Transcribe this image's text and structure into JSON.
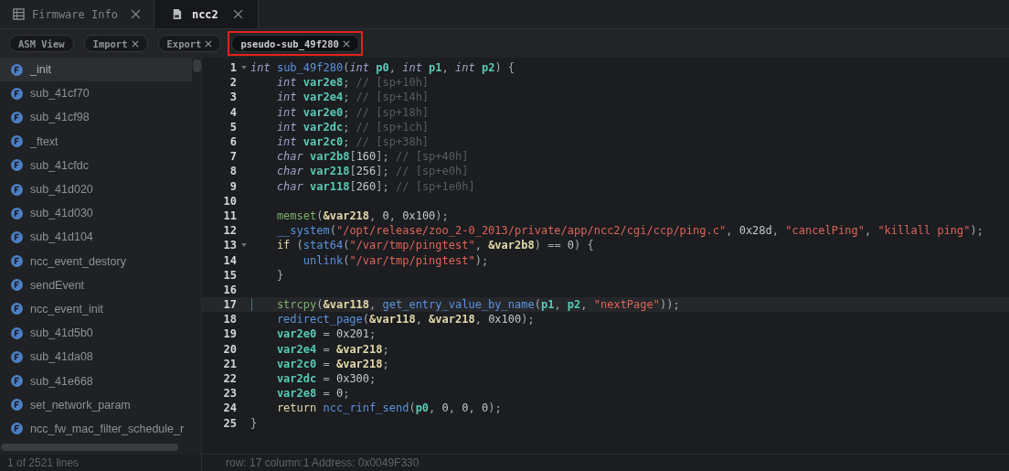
{
  "top_tabs": [
    {
      "label": "Firmware Info",
      "selected": false
    },
    {
      "label": "ncc2",
      "selected": true
    }
  ],
  "view_tabs": [
    {
      "label": "ASM View",
      "closable": false,
      "highlighted": false,
      "selected": false
    },
    {
      "label": "Import",
      "closable": true,
      "highlighted": false,
      "selected": false
    },
    {
      "label": "Export",
      "closable": true,
      "highlighted": false,
      "selected": false
    },
    {
      "label": "pseudo-sub_49f280",
      "closable": true,
      "highlighted": true,
      "selected": true
    }
  ],
  "sidebar": {
    "items": [
      {
        "name": "_init",
        "selected": true
      },
      {
        "name": "sub_41cf70",
        "selected": false
      },
      {
        "name": "sub_41cf98",
        "selected": false
      },
      {
        "name": "_ftext",
        "selected": false
      },
      {
        "name": "sub_41cfdc",
        "selected": false
      },
      {
        "name": "sub_41d020",
        "selected": false
      },
      {
        "name": "sub_41d030",
        "selected": false
      },
      {
        "name": "sub_41d104",
        "selected": false
      },
      {
        "name": "ncc_event_destory",
        "selected": false
      },
      {
        "name": "sendEvent",
        "selected": false
      },
      {
        "name": "ncc_event_init",
        "selected": false
      },
      {
        "name": "sub_41d5b0",
        "selected": false
      },
      {
        "name": "sub_41da08",
        "selected": false
      },
      {
        "name": "sub_41e668",
        "selected": false
      },
      {
        "name": "set_network_param",
        "selected": false
      },
      {
        "name": "ncc_fw_mac_filter_schedule_r",
        "selected": false
      }
    ],
    "status": "1 of 2521 lines"
  },
  "editor": {
    "lines": [
      {
        "n": "1",
        "fold": true,
        "current": false,
        "tokens": [
          {
            "t": "int ",
            "kind": "type"
          },
          {
            "t": "sub_49f280",
            "kind": "func"
          },
          {
            "t": "(",
            "kind": "p"
          },
          {
            "t": "int ",
            "kind": "type"
          },
          {
            "t": "p0",
            "kind": "var"
          },
          {
            "t": ", ",
            "kind": "p"
          },
          {
            "t": "int ",
            "kind": "type"
          },
          {
            "t": "p1",
            "kind": "var"
          },
          {
            "t": ", ",
            "kind": "p"
          },
          {
            "t": "int ",
            "kind": "type"
          },
          {
            "t": "p2",
            "kind": "var"
          },
          {
            "t": ") {",
            "kind": "p"
          }
        ]
      },
      {
        "n": "2",
        "fold": false,
        "current": false,
        "tokens": [
          {
            "t": "    int ",
            "kind": "type"
          },
          {
            "t": "var2e8",
            "kind": "var"
          },
          {
            "t": "; ",
            "kind": "p"
          },
          {
            "t": "// [sp+10h]",
            "kind": "comment"
          }
        ]
      },
      {
        "n": "3",
        "fold": false,
        "current": false,
        "tokens": [
          {
            "t": "    int ",
            "kind": "type"
          },
          {
            "t": "var2e4",
            "kind": "var"
          },
          {
            "t": "; ",
            "kind": "p"
          },
          {
            "t": "// [sp+14h]",
            "kind": "comment"
          }
        ]
      },
      {
        "n": "4",
        "fold": false,
        "current": false,
        "tokens": [
          {
            "t": "    int ",
            "kind": "type"
          },
          {
            "t": "var2e0",
            "kind": "var"
          },
          {
            "t": "; ",
            "kind": "p"
          },
          {
            "t": "// [sp+18h]",
            "kind": "comment"
          }
        ]
      },
      {
        "n": "5",
        "fold": false,
        "current": false,
        "tokens": [
          {
            "t": "    int ",
            "kind": "type"
          },
          {
            "t": "var2dc",
            "kind": "var"
          },
          {
            "t": "; ",
            "kind": "p"
          },
          {
            "t": "// [sp+1ch]",
            "kind": "comment"
          }
        ]
      },
      {
        "n": "6",
        "fold": false,
        "current": false,
        "tokens": [
          {
            "t": "    int ",
            "kind": "type"
          },
          {
            "t": "var2c0",
            "kind": "var"
          },
          {
            "t": "; ",
            "kind": "p"
          },
          {
            "t": "// [sp+38h]",
            "kind": "comment"
          }
        ]
      },
      {
        "n": "7",
        "fold": false,
        "current": false,
        "tokens": [
          {
            "t": "    char ",
            "kind": "type"
          },
          {
            "t": "var2b8",
            "kind": "var"
          },
          {
            "t": "[",
            "kind": "p"
          },
          {
            "t": "160",
            "kind": "num"
          },
          {
            "t": "]; ",
            "kind": "p"
          },
          {
            "t": "// [sp+40h]",
            "kind": "comment"
          }
        ]
      },
      {
        "n": "8",
        "fold": false,
        "current": false,
        "tokens": [
          {
            "t": "    char ",
            "kind": "type"
          },
          {
            "t": "var218",
            "kind": "var"
          },
          {
            "t": "[",
            "kind": "p"
          },
          {
            "t": "256",
            "kind": "num"
          },
          {
            "t": "]; ",
            "kind": "p"
          },
          {
            "t": "// [sp+e0h]",
            "kind": "comment"
          }
        ]
      },
      {
        "n": "9",
        "fold": false,
        "current": false,
        "tokens": [
          {
            "t": "    char ",
            "kind": "type"
          },
          {
            "t": "var118",
            "kind": "var"
          },
          {
            "t": "[",
            "kind": "p"
          },
          {
            "t": "260",
            "kind": "num"
          },
          {
            "t": "]; ",
            "kind": "p"
          },
          {
            "t": "// [sp+1e0h]",
            "kind": "comment"
          }
        ]
      },
      {
        "n": "10",
        "fold": false,
        "current": false
      },
      {
        "n": "11",
        "fold": false,
        "current": false,
        "tokens": [
          {
            "t": "    memset",
            "kind": "lib"
          },
          {
            "t": "(",
            "kind": "p"
          },
          {
            "t": "&var218",
            "kind": "ref"
          },
          {
            "t": ", ",
            "kind": "p"
          },
          {
            "t": "0",
            "kind": "num"
          },
          {
            "t": ", ",
            "kind": "p"
          },
          {
            "t": "0x100",
            "kind": "num"
          },
          {
            "t": ");",
            "kind": "p"
          }
        ]
      },
      {
        "n": "12",
        "fold": false,
        "current": false,
        "tokens": [
          {
            "t": "    __system",
            "kind": "func"
          },
          {
            "t": "(",
            "kind": "p"
          },
          {
            "t": "\"/opt/release/zoo_2-0_2013/private/app/ncc2/cgi/ccp/ping.c\"",
            "kind": "str"
          },
          {
            "t": ", ",
            "kind": "p"
          },
          {
            "t": "0x28d",
            "kind": "num"
          },
          {
            "t": ", ",
            "kind": "p"
          },
          {
            "t": "\"cancelPing\"",
            "kind": "str"
          },
          {
            "t": ", ",
            "kind": "p"
          },
          {
            "t": "\"killall ping\"",
            "kind": "str"
          },
          {
            "t": ");",
            "kind": "p"
          }
        ]
      },
      {
        "n": "13",
        "fold": true,
        "current": false,
        "tokens": [
          {
            "t": "    if",
            "kind": "kw"
          },
          {
            "t": " (",
            "kind": "p"
          },
          {
            "t": "stat64",
            "kind": "func"
          },
          {
            "t": "(",
            "kind": "p"
          },
          {
            "t": "\"/var/tmp/pingtest\"",
            "kind": "str"
          },
          {
            "t": ", ",
            "kind": "p"
          },
          {
            "t": "&var2b8",
            "kind": "ref"
          },
          {
            "t": ") == ",
            "kind": "p"
          },
          {
            "t": "0",
            "kind": "num"
          },
          {
            "t": ") {",
            "kind": "p"
          }
        ]
      },
      {
        "n": "14",
        "fold": false,
        "current": false,
        "tokens": [
          {
            "t": "        unlink",
            "kind": "func"
          },
          {
            "t": "(",
            "kind": "p"
          },
          {
            "t": "\"/var/tmp/pingtest\"",
            "kind": "str"
          },
          {
            "t": ");",
            "kind": "p"
          }
        ]
      },
      {
        "n": "15",
        "fold": false,
        "current": false,
        "tokens": [
          {
            "t": "    }",
            "kind": "p"
          }
        ]
      },
      {
        "n": "16",
        "fold": false,
        "current": false
      },
      {
        "n": "17",
        "fold": false,
        "current": true,
        "tokens": [
          {
            "t": "    strcpy",
            "kind": "lib"
          },
          {
            "t": "(",
            "kind": "p"
          },
          {
            "t": "&var118",
            "kind": "ref"
          },
          {
            "t": ", ",
            "kind": "p"
          },
          {
            "t": "get_entry_value_by_name",
            "kind": "func"
          },
          {
            "t": "(",
            "kind": "p"
          },
          {
            "t": "p1",
            "kind": "var"
          },
          {
            "t": ", ",
            "kind": "p"
          },
          {
            "t": "p2",
            "kind": "var"
          },
          {
            "t": ", ",
            "kind": "p"
          },
          {
            "t": "\"nextPage\"",
            "kind": "str"
          },
          {
            "t": "));",
            "kind": "p"
          }
        ]
      },
      {
        "n": "18",
        "fold": false,
        "current": false,
        "tokens": [
          {
            "t": "    redirect_page",
            "kind": "func"
          },
          {
            "t": "(",
            "kind": "p"
          },
          {
            "t": "&var118",
            "kind": "ref"
          },
          {
            "t": ", ",
            "kind": "p"
          },
          {
            "t": "&var218",
            "kind": "ref"
          },
          {
            "t": ", ",
            "kind": "p"
          },
          {
            "t": "0x100",
            "kind": "num"
          },
          {
            "t": ");",
            "kind": "p"
          }
        ]
      },
      {
        "n": "19",
        "fold": false,
        "current": false,
        "tokens": [
          {
            "t": "    var2e0",
            "kind": "var"
          },
          {
            "t": " = ",
            "kind": "p"
          },
          {
            "t": "0x201",
            "kind": "num"
          },
          {
            "t": ";",
            "kind": "p"
          }
        ]
      },
      {
        "n": "20",
        "fold": false,
        "current": false,
        "tokens": [
          {
            "t": "    var2e4",
            "kind": "var"
          },
          {
            "t": " = ",
            "kind": "p"
          },
          {
            "t": "&var218",
            "kind": "ref"
          },
          {
            "t": ";",
            "kind": "p"
          }
        ]
      },
      {
        "n": "21",
        "fold": false,
        "current": false,
        "tokens": [
          {
            "t": "    var2c0",
            "kind": "var"
          },
          {
            "t": " = ",
            "kind": "p"
          },
          {
            "t": "&var218",
            "kind": "ref"
          },
          {
            "t": ";",
            "kind": "p"
          }
        ]
      },
      {
        "n": "22",
        "fold": false,
        "current": false,
        "tokens": [
          {
            "t": "    var2dc",
            "kind": "var"
          },
          {
            "t": " = ",
            "kind": "p"
          },
          {
            "t": "0x300",
            "kind": "num"
          },
          {
            "t": ";",
            "kind": "p"
          }
        ]
      },
      {
        "n": "23",
        "fold": false,
        "current": false,
        "tokens": [
          {
            "t": "    var2e8",
            "kind": "var"
          },
          {
            "t": " = ",
            "kind": "p"
          },
          {
            "t": "0",
            "kind": "num"
          },
          {
            "t": ";",
            "kind": "p"
          }
        ]
      },
      {
        "n": "24",
        "fold": false,
        "current": false,
        "tokens": [
          {
            "t": "    return ",
            "kind": "kw"
          },
          {
            "t": "ncc_rinf_send",
            "kind": "func"
          },
          {
            "t": "(",
            "kind": "p"
          },
          {
            "t": "p0",
            "kind": "var"
          },
          {
            "t": ", ",
            "kind": "p"
          },
          {
            "t": "0",
            "kind": "num"
          },
          {
            "t": ", ",
            "kind": "p"
          },
          {
            "t": "0",
            "kind": "num"
          },
          {
            "t": ", ",
            "kind": "p"
          },
          {
            "t": "0",
            "kind": "num"
          },
          {
            "t": ");",
            "kind": "p"
          }
        ]
      },
      {
        "n": "25",
        "fold": false,
        "current": false,
        "tokens": [
          {
            "t": "}",
            "kind": "p"
          }
        ]
      }
    ],
    "status": "row: 17 column:1 Address: 0x0049F330"
  }
}
